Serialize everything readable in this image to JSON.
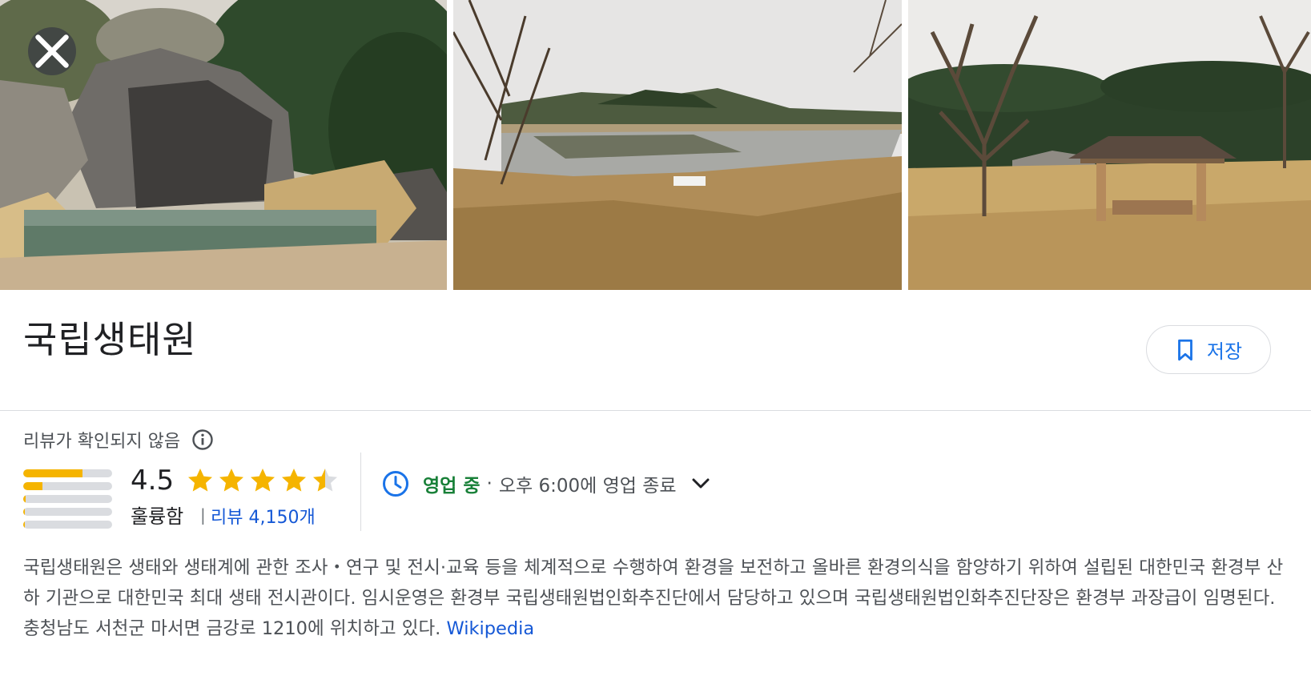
{
  "place": {
    "title": "국립생태원"
  },
  "toolbar": {
    "save_label": "저장"
  },
  "rating": {
    "unverified_label": "리뷰가 확인되지 않음",
    "score": "4.5",
    "score_value": 4.5,
    "max_stars": 5,
    "rating_word": "훌륭함",
    "separator": "|",
    "reviews_label": "리뷰 4,150개",
    "distribution": [
      0.67,
      0.22,
      0.03,
      0.02,
      0.02
    ],
    "bar_color": "#f5b400"
  },
  "hours": {
    "status": "영업 중",
    "dot": "·",
    "close_text": "오후 6:00에 영업 종료"
  },
  "description": {
    "text": "국립생태원은 생태와 생태계에 관한 조사・연구 및 전시·교육 등을 체계적으로 수행하여 환경을 보전하고 올바른 환경의식을 함양하기 위하여 설립된 대한민국 환경부 산하 기관으로 대한민국 최대 생태 전시관이다. 임시운영은 환경부 국립생태원법인화추진단에서 담당하고 있으며 국립생태원법인화추진단장은 환경부 과장급이 임명된다. 충청남도 서천군 마서면 금강로 1210에 위치하고 있다.",
    "source_label": "Wikipedia"
  },
  "icons": {
    "close": "close-icon",
    "bookmark": "bookmark-icon",
    "info": "info-icon",
    "clock": "clock-icon",
    "expand": "chevron-down-icon"
  },
  "colors": {
    "accent": "#1a73e8",
    "open_green": "#188038",
    "star": "#f5b400"
  }
}
